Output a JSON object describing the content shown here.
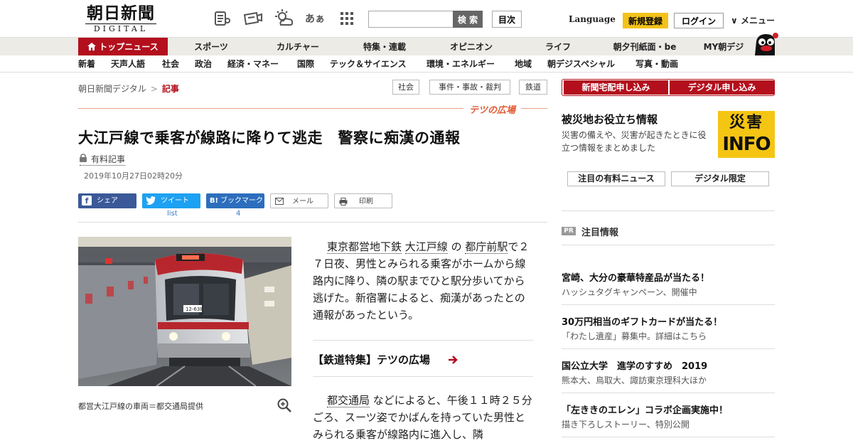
{
  "header": {
    "logo_main": "朝日新聞",
    "logo_sub": "DIGITAL",
    "search_placeholder": "",
    "search_button": "検 索",
    "toc_button": "目次",
    "language": "Language",
    "signup": "新規登録",
    "login": "ログイン",
    "menu": "メニュー",
    "font_size_icon_text": "あぁ"
  },
  "nav_primary": [
    {
      "label": "トップニュース",
      "active": true
    },
    {
      "label": "スポーツ"
    },
    {
      "label": "カルチャー"
    },
    {
      "label": "特集・連載"
    },
    {
      "label": "オピニオン"
    },
    {
      "label": "ライフ"
    },
    {
      "label": "朝夕刊紙面・be"
    },
    {
      "label": "MY朝デジ"
    }
  ],
  "nav_secondary": [
    "新着",
    "天声人語",
    "社会",
    "政治",
    "経済・マネー",
    "国際",
    "テック＆サイエンス",
    "環境・エネルギー",
    "地域",
    "朝デジスペシャル",
    "写真・動画"
  ],
  "breadcrumb": {
    "home": "朝日新聞デジタル",
    "sep": ">",
    "current": "記事"
  },
  "tags": [
    "社会",
    "事件・事故・裁判",
    "鉄道"
  ],
  "section_label": "テツの広場",
  "article": {
    "headline": "大江戸線で乗客が線路に降りて逃走　警察に痴漢の通報",
    "paid_label": "有料記事",
    "date": "2019年10月27日02時20分",
    "caption": "都営大江戸線の車両＝都交通局提供",
    "para1_links": [
      "東京都営地下鉄",
      "大江戸線",
      "都庁前駅"
    ],
    "para1_joiner": "の",
    "para1_rest": "で２７日夜、男性とみられる乗客がホームから線路内に降り、隣の駅までひと駅分歩いてから逃げた。新宿署によると、痴漢があったとの通報があったという。",
    "feature_link": "【鉄道特集】テツの広場",
    "para2_link": "都交通局",
    "para2_rest": "などによると、午後１１時２５分ごろ、スーツ姿でかばんを持っていた男性とみられる乗客が線路内に進入し、隣",
    "train_number": "12-638"
  },
  "share": {
    "facebook": "シェア",
    "twitter": "ツイート",
    "twitter_count": "list",
    "hatena": "ブックマーク",
    "hatena_icon": "B!",
    "hatena_count": "4",
    "mail": "メール",
    "print": "印刷"
  },
  "sidebar": {
    "sub_home": "新聞宅配申し込み",
    "sub_digital": "デジタル申し込み",
    "info_title": "被災地お役立ち情報",
    "info_desc": "災害の備えや、災害が起きたときに役立つ情報をまとめました",
    "info_badge_1": "災害",
    "info_badge_2": "INFO",
    "tabs": [
      "注目の有料ニュース",
      "デジタル限定"
    ],
    "pr_badge": "PR",
    "pr_title": "注目情報",
    "pr_items": [
      {
        "title": "宮崎、大分の豪華特産品が当たる！",
        "sub": "ハッシュタグキャンペーン、開催中"
      },
      {
        "title": "30万円相当のギフトカードが当たる！",
        "sub": "「わたし遺産」募集中。詳細はこちら"
      },
      {
        "title": "国公立大学　進学のすすめ　2019",
        "sub": "熊本大、鳥取大、諏訪東京理科大ほか"
      },
      {
        "title": "「左ききのエレン」コラボ企画実施中！",
        "sub": "描き下ろしストーリー、特別公開"
      }
    ]
  },
  "colors": {
    "brand_red": "#b30f1d",
    "accent_orange": "#e05a32",
    "signup_yellow": "#f3c21a"
  }
}
